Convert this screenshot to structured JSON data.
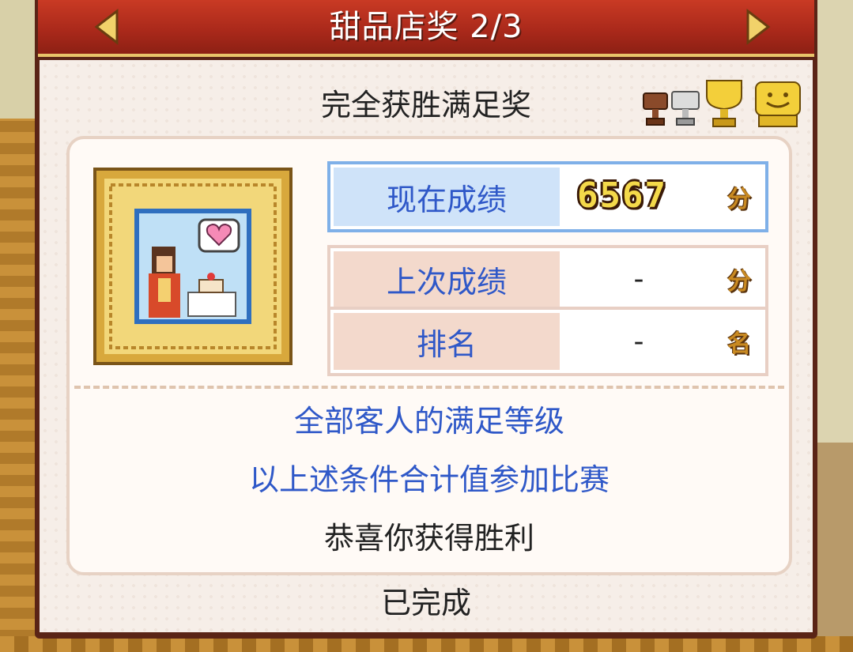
{
  "title": {
    "text": "甜品店奖 2/3",
    "prev_icon": "triangle-left-icon",
    "next_icon": "triangle-right-icon"
  },
  "award": {
    "name": "完全获胜满足奖",
    "trophies": [
      "bronze-trophy-icon",
      "silver-trophy-icon",
      "gold-trophy-icon",
      "smiley-trophy-icon"
    ]
  },
  "stats": {
    "current": {
      "label": "现在成绩",
      "value": "6567",
      "unit_icon": "points-icon"
    },
    "last": {
      "label": "上次成绩",
      "value": "-",
      "unit_icon": "points-icon"
    },
    "rank": {
      "label": "排名",
      "value": "-",
      "unit_icon": "rank-icon"
    }
  },
  "description": {
    "line1": "全部客人的满足等级",
    "line2": "以上述条件合计值参加比赛",
    "line3": "恭喜你获得胜利"
  },
  "status": "已完成",
  "colors": {
    "title_bar": "#b32d1c",
    "label_blue": "#2f58c8",
    "current_row_border": "#7fb0e8",
    "row_border": "#e8cfc4"
  }
}
